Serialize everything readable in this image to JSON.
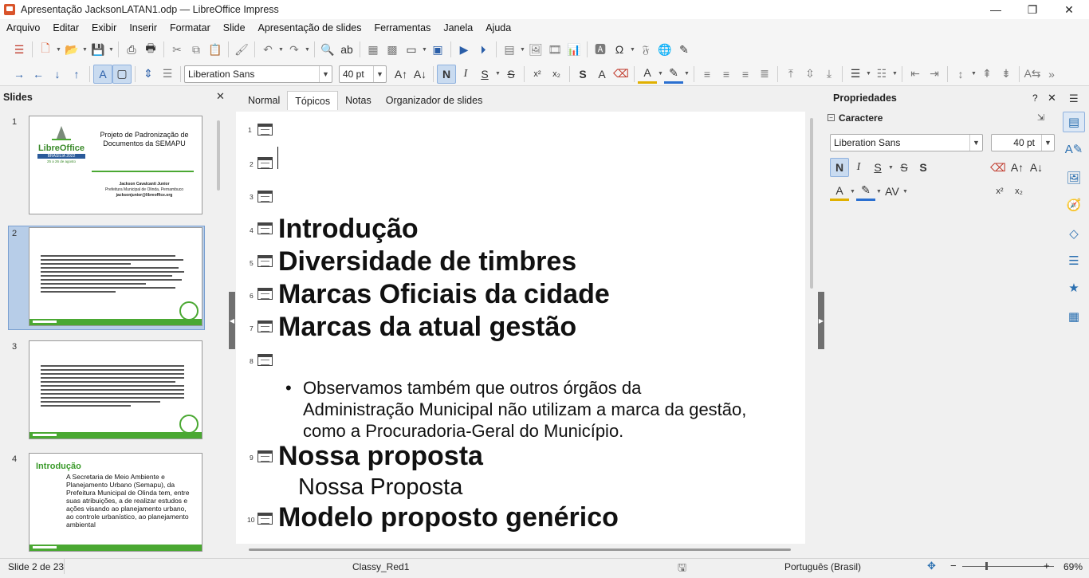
{
  "window": {
    "title": "Apresentação JacksonLATAN1.odp — LibreOffice Impress",
    "controls": [
      "—",
      "❐",
      "✕"
    ]
  },
  "menu": [
    "Arquivo",
    "Editar",
    "Exibir",
    "Inserir",
    "Formatar",
    "Slide",
    "Apresentação de slides",
    "Ferramentas",
    "Janela",
    "Ajuda"
  ],
  "format_toolbar": {
    "font_name": "Liberation Sans",
    "font_size": "40 pt",
    "bold": "N",
    "italic": "I",
    "underline": "S",
    "strikethrough": "S",
    "shadow": "S",
    "outline_font": "A",
    "superscript": "x²",
    "subscript": "x₂"
  },
  "slides_panel": {
    "title": "Slides",
    "selected": 2,
    "thumbs": [
      {
        "num": "1",
        "title": "Projeto de Padronização de Documentos da SEMAPU",
        "conf_name": "LibreOffice",
        "conf_place": "BRASÍLIA 2022",
        "conf_date": "25 a 26 de agosto",
        "author": "Jackson Cavalcanti Junior",
        "org": "Prefeitura Municipal de Olinda, Pernambuco",
        "email": "jacksonjunior@libreoffice.org"
      },
      {
        "num": "2"
      },
      {
        "num": "3"
      },
      {
        "num": "4",
        "heading": "Introdução",
        "text": "A Secretaria de Meio Ambiente e Planejamento Urbano (Semapu), da Prefeitura Municipal de Olinda tem, entre suas atribuições, a de realizar estudos e ações visando ao planejamento urbano, ao controle urbanístico, ao planejamento ambiental"
      }
    ]
  },
  "tabs": [
    {
      "label": "Normal",
      "active": false
    },
    {
      "label": "Tópicos",
      "active": true
    },
    {
      "label": "Notas",
      "active": false
    },
    {
      "label": "Organizador de slides",
      "active": false
    }
  ],
  "outline": {
    "entries": [
      {
        "num": "1",
        "title": ""
      },
      {
        "num": "2",
        "title": ""
      },
      {
        "num": "3",
        "title": ""
      },
      {
        "num": "4",
        "title": "Introdução"
      },
      {
        "num": "5",
        "title": "Diversidade de timbres"
      },
      {
        "num": "6",
        "title": "Marcas Oficiais da cidade"
      },
      {
        "num": "7",
        "title": "Marcas da atual gestão"
      },
      {
        "num": "8",
        "title": ""
      },
      {
        "num": "9",
        "title": "Nossa proposta"
      },
      {
        "num": "10",
        "title": "Modelo proposto genérico"
      }
    ],
    "slide8_bullet": "Observamos também que outros órgãos da Administração Municipal não utilizam a marca da gestão, como a Procuradoria-Geral do Município.",
    "slide9_sub": "Nossa Proposta"
  },
  "properties": {
    "title": "Propriedades",
    "section": "Caractere",
    "font_name": "Liberation Sans",
    "font_size": "40 pt",
    "bold": "N",
    "italic": "I",
    "underline": "S",
    "strike": "S",
    "shadow": "S",
    "superscript": "x²",
    "subscript": "x₂"
  },
  "status": {
    "slide_pos": "Slide 2 de 23",
    "master": "Classy_Red1",
    "language": "Português (Brasil)",
    "zoom": "69%"
  },
  "colors": {
    "accent_blue": "#2a5ea8",
    "slide_green": "#4aa832",
    "selected_bg": "#b7cde8"
  }
}
